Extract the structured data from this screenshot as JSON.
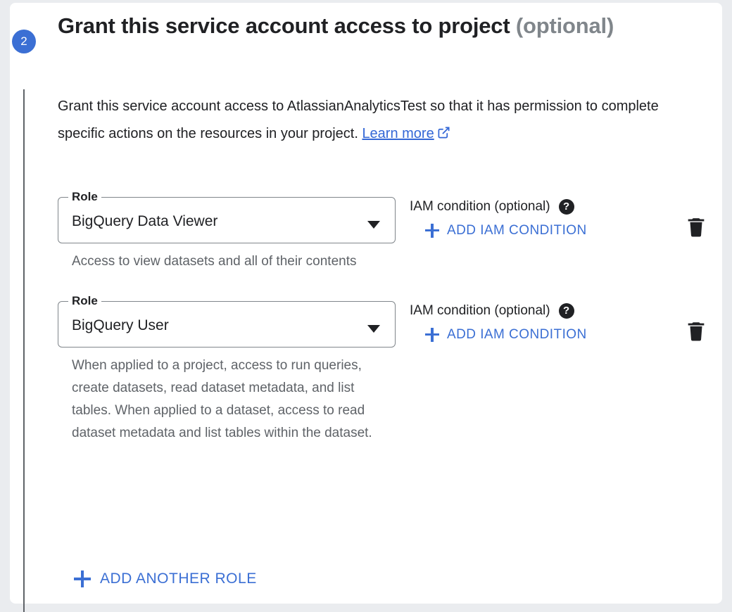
{
  "step": {
    "number": "2",
    "badge_color": "#3b6fd4"
  },
  "header": {
    "title_main": "Grant this service account access to project",
    "title_optional": "(optional)"
  },
  "description": {
    "text_before_link": "Grant this service account access to AtlassianAnalyticsTest so that it has permission to complete specific actions on the resources in your project. ",
    "link_label": "Learn more",
    "link_icon": "open-in-new-icon"
  },
  "roles": [
    {
      "label": "Role",
      "value": "BigQuery Data Viewer",
      "help_text": "Access to view datasets and all of their contents",
      "iam_label": "IAM condition (optional)",
      "iam_help_icon": "?",
      "add_iam_label": "ADD IAM CONDITION",
      "delete_icon": "delete-icon"
    },
    {
      "label": "Role",
      "value": "BigQuery User",
      "help_text": "When applied to a project, access to run queries, create datasets, read dataset metadata, and list tables. When applied to a dataset, access to read dataset metadata and list tables within the dataset.",
      "iam_label": "IAM condition (optional)",
      "iam_help_icon": "?",
      "add_iam_label": "ADD IAM CONDITION",
      "delete_icon": "delete-icon"
    }
  ],
  "footer": {
    "add_another_role_label": "ADD ANOTHER ROLE"
  },
  "colors": {
    "accent_blue": "#3b6fd4",
    "link_blue": "#3367d6",
    "text_primary": "#202124",
    "text_secondary": "#5f6368",
    "page_background": "#eaecef",
    "card_background": "#ffffff"
  }
}
